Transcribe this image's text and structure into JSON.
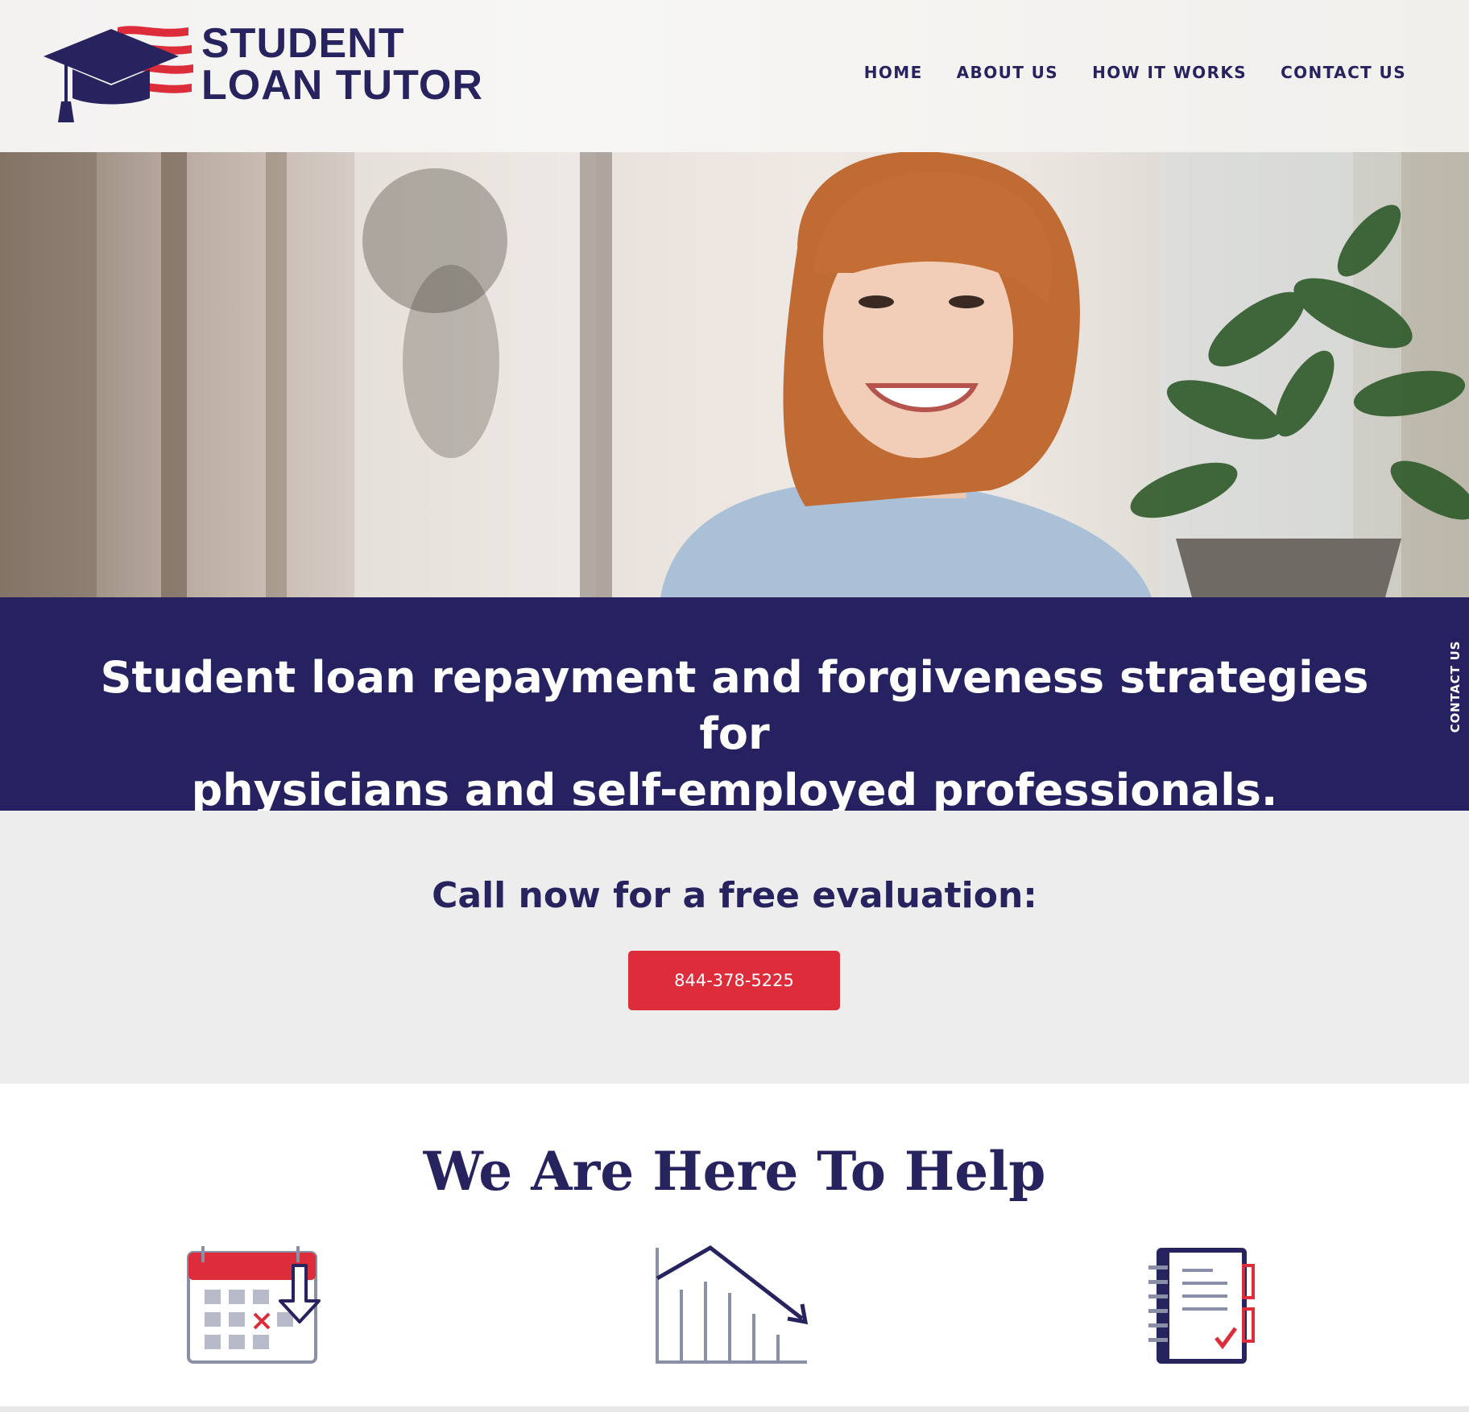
{
  "header": {
    "logo": {
      "line1": "STUDENT",
      "line2": "LOAN TUTOR",
      "icon": "graduation-cap-flag-icon"
    },
    "nav": [
      {
        "label": "HOME"
      },
      {
        "label": "ABOUT US"
      },
      {
        "label": "HOW IT WORKS"
      },
      {
        "label": "CONTACT US"
      }
    ]
  },
  "hero": {
    "image": "smiling-woman-with-plant-photo"
  },
  "banner": {
    "line1": "Student loan repayment and forgiveness strategies for",
    "line2": "physicians and self-employed professionals."
  },
  "side_tab": {
    "label": "CONTACT US"
  },
  "cta": {
    "title": "Call now for a free evaluation:",
    "phone_button": "844-378-5225"
  },
  "help": {
    "title": "We Are Here To Help",
    "icons": [
      "calendar-cancel-icon",
      "declining-chart-icon",
      "notebook-checklist-icon"
    ]
  },
  "colors": {
    "navy": "#262262",
    "red": "#dd2c3a",
    "light_gray": "#ededed"
  }
}
